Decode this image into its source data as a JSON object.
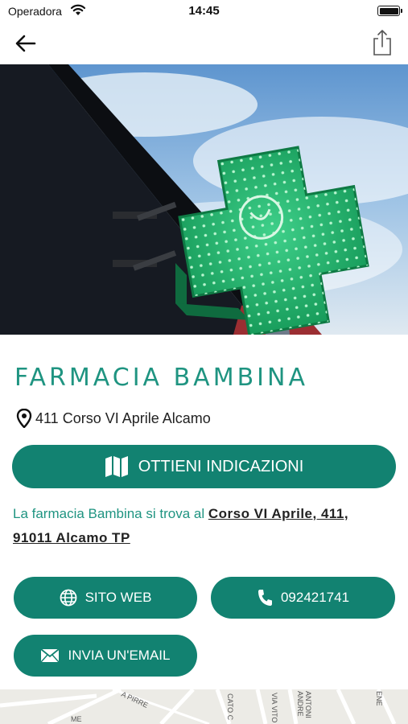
{
  "status_bar": {
    "carrier": "Operadora",
    "time": "14:45"
  },
  "nav": {
    "back_icon": "back-arrow-icon",
    "share_icon": "share-icon"
  },
  "pharmacy": {
    "name": "FARMACIA BAMBINA",
    "address": "411 Corso VI Aprile Alcamo",
    "directions_label": "OTTIENI INDICAZIONI",
    "description_prefix": "La farmacia Bambina si trova al ",
    "description_link": "Corso VI Aprile, 411, 91011 Alcamo TP"
  },
  "actions": {
    "website_label": "SITO WEB",
    "phone_label": "092421741",
    "email_label": "INVIA UN'EMAIL"
  },
  "map": {
    "labels": [
      "A PIRRE",
      "CATO C",
      "VIA VITO",
      "ANDRE",
      "ANTONI",
      "ENE",
      "ME"
    ]
  },
  "colors": {
    "accent": "#128271",
    "title_text": "#1f9481",
    "background": "#ffffff"
  }
}
